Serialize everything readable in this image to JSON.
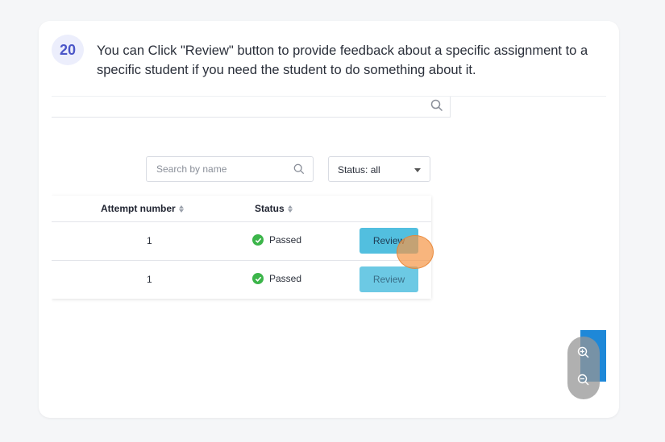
{
  "step": {
    "number": "20",
    "instruction": "You can Click \"Review\" button to provide feedback about a specific assignment to a specific student if you need the student to do something about it."
  },
  "filters": {
    "search_placeholder": "Search by name",
    "status_label": "Status: all"
  },
  "table": {
    "headers": {
      "attempt": "Attempt number",
      "status": "Status"
    },
    "rows": [
      {
        "attempt": "1",
        "status": "Passed",
        "action": "Review"
      },
      {
        "attempt": "1",
        "status": "Passed",
        "action": "Review"
      }
    ]
  },
  "colors": {
    "badge_bg": "#eceefc",
    "badge_text": "#4b56c8",
    "review_button": "#52bfdf",
    "passed_icon": "#3cb54a",
    "cursor_highlight": "#f5964a"
  },
  "icons": [
    "search-icon",
    "sort-icon",
    "check-circle-icon",
    "chevron-down-icon",
    "zoom-in-icon",
    "zoom-out-icon"
  ]
}
